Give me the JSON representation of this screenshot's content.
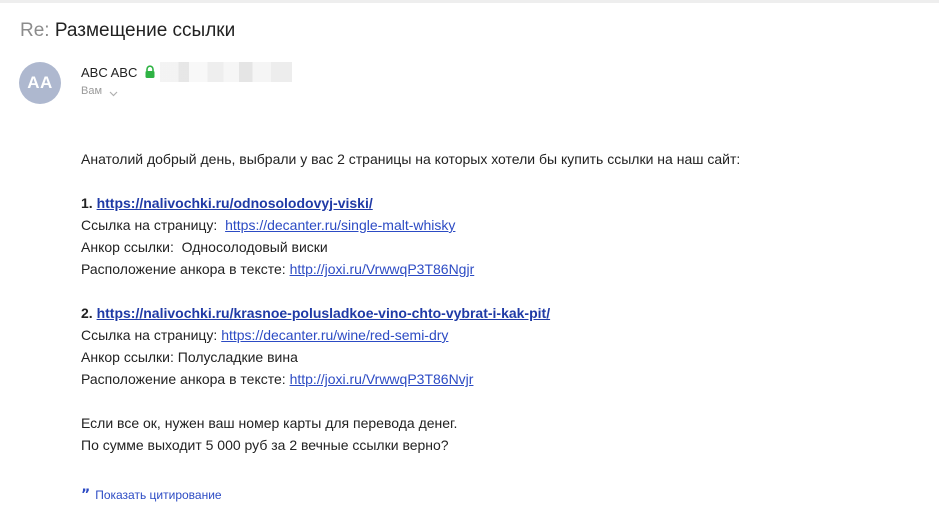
{
  "subject": {
    "prefix": "Re:",
    "title": "Размещение ссылки"
  },
  "sender": {
    "avatar_initials": "AA",
    "avatar_color": "#aeb8cf",
    "name": "ABC ABC",
    "verified_icon": "lock-icon",
    "verified_color": "#2fb344",
    "recipient_label": "Вам"
  },
  "message": {
    "intro": "Анатолий добрый день, выбрали у вас 2 страницы на которых хотели бы купить ссылки на наш сайт:",
    "items": [
      {
        "number": "1.",
        "url": "https://nalivochki.ru/odnosolodovyj-viski/",
        "page_label": "Ссылка на страницу:",
        "page_url": "https://decanter.ru/single-malt-whisky",
        "anchor_label": "Анкор ссылки:",
        "anchor_value": "Односолодовый виски",
        "location_label": "Расположение анкора в тексте:",
        "location_url": "http://joxi.ru/VrwwqP3T86Ngjr"
      },
      {
        "number": "2.",
        "url": "https://nalivochki.ru/krasnoe-polusladkoe-vino-chto-vybrat-i-kak-pit/",
        "page_label": "Ссылка на страницу:",
        "page_url": "https://decanter.ru/wine/red-semi-dry",
        "anchor_label": "Анкор ссылки:",
        "anchor_value": "Полусладкие вина",
        "location_label": "Расположение анкора в тексте:",
        "location_url": "http://joxi.ru/VrwwqP3T86Nvjr"
      }
    ],
    "closing_1": "Если все ок, нужен ваш номер карты для перевода денег.",
    "closing_2": "По сумме выходит 5 000 руб за 2 вечные ссылки верно?"
  },
  "quote_toggle": {
    "icon": "quote-icon",
    "label": "Показать цитирование"
  },
  "colors": {
    "link": "#2c4bc4",
    "link_bold": "#1f3aa6",
    "muted": "#9a9a9a"
  }
}
